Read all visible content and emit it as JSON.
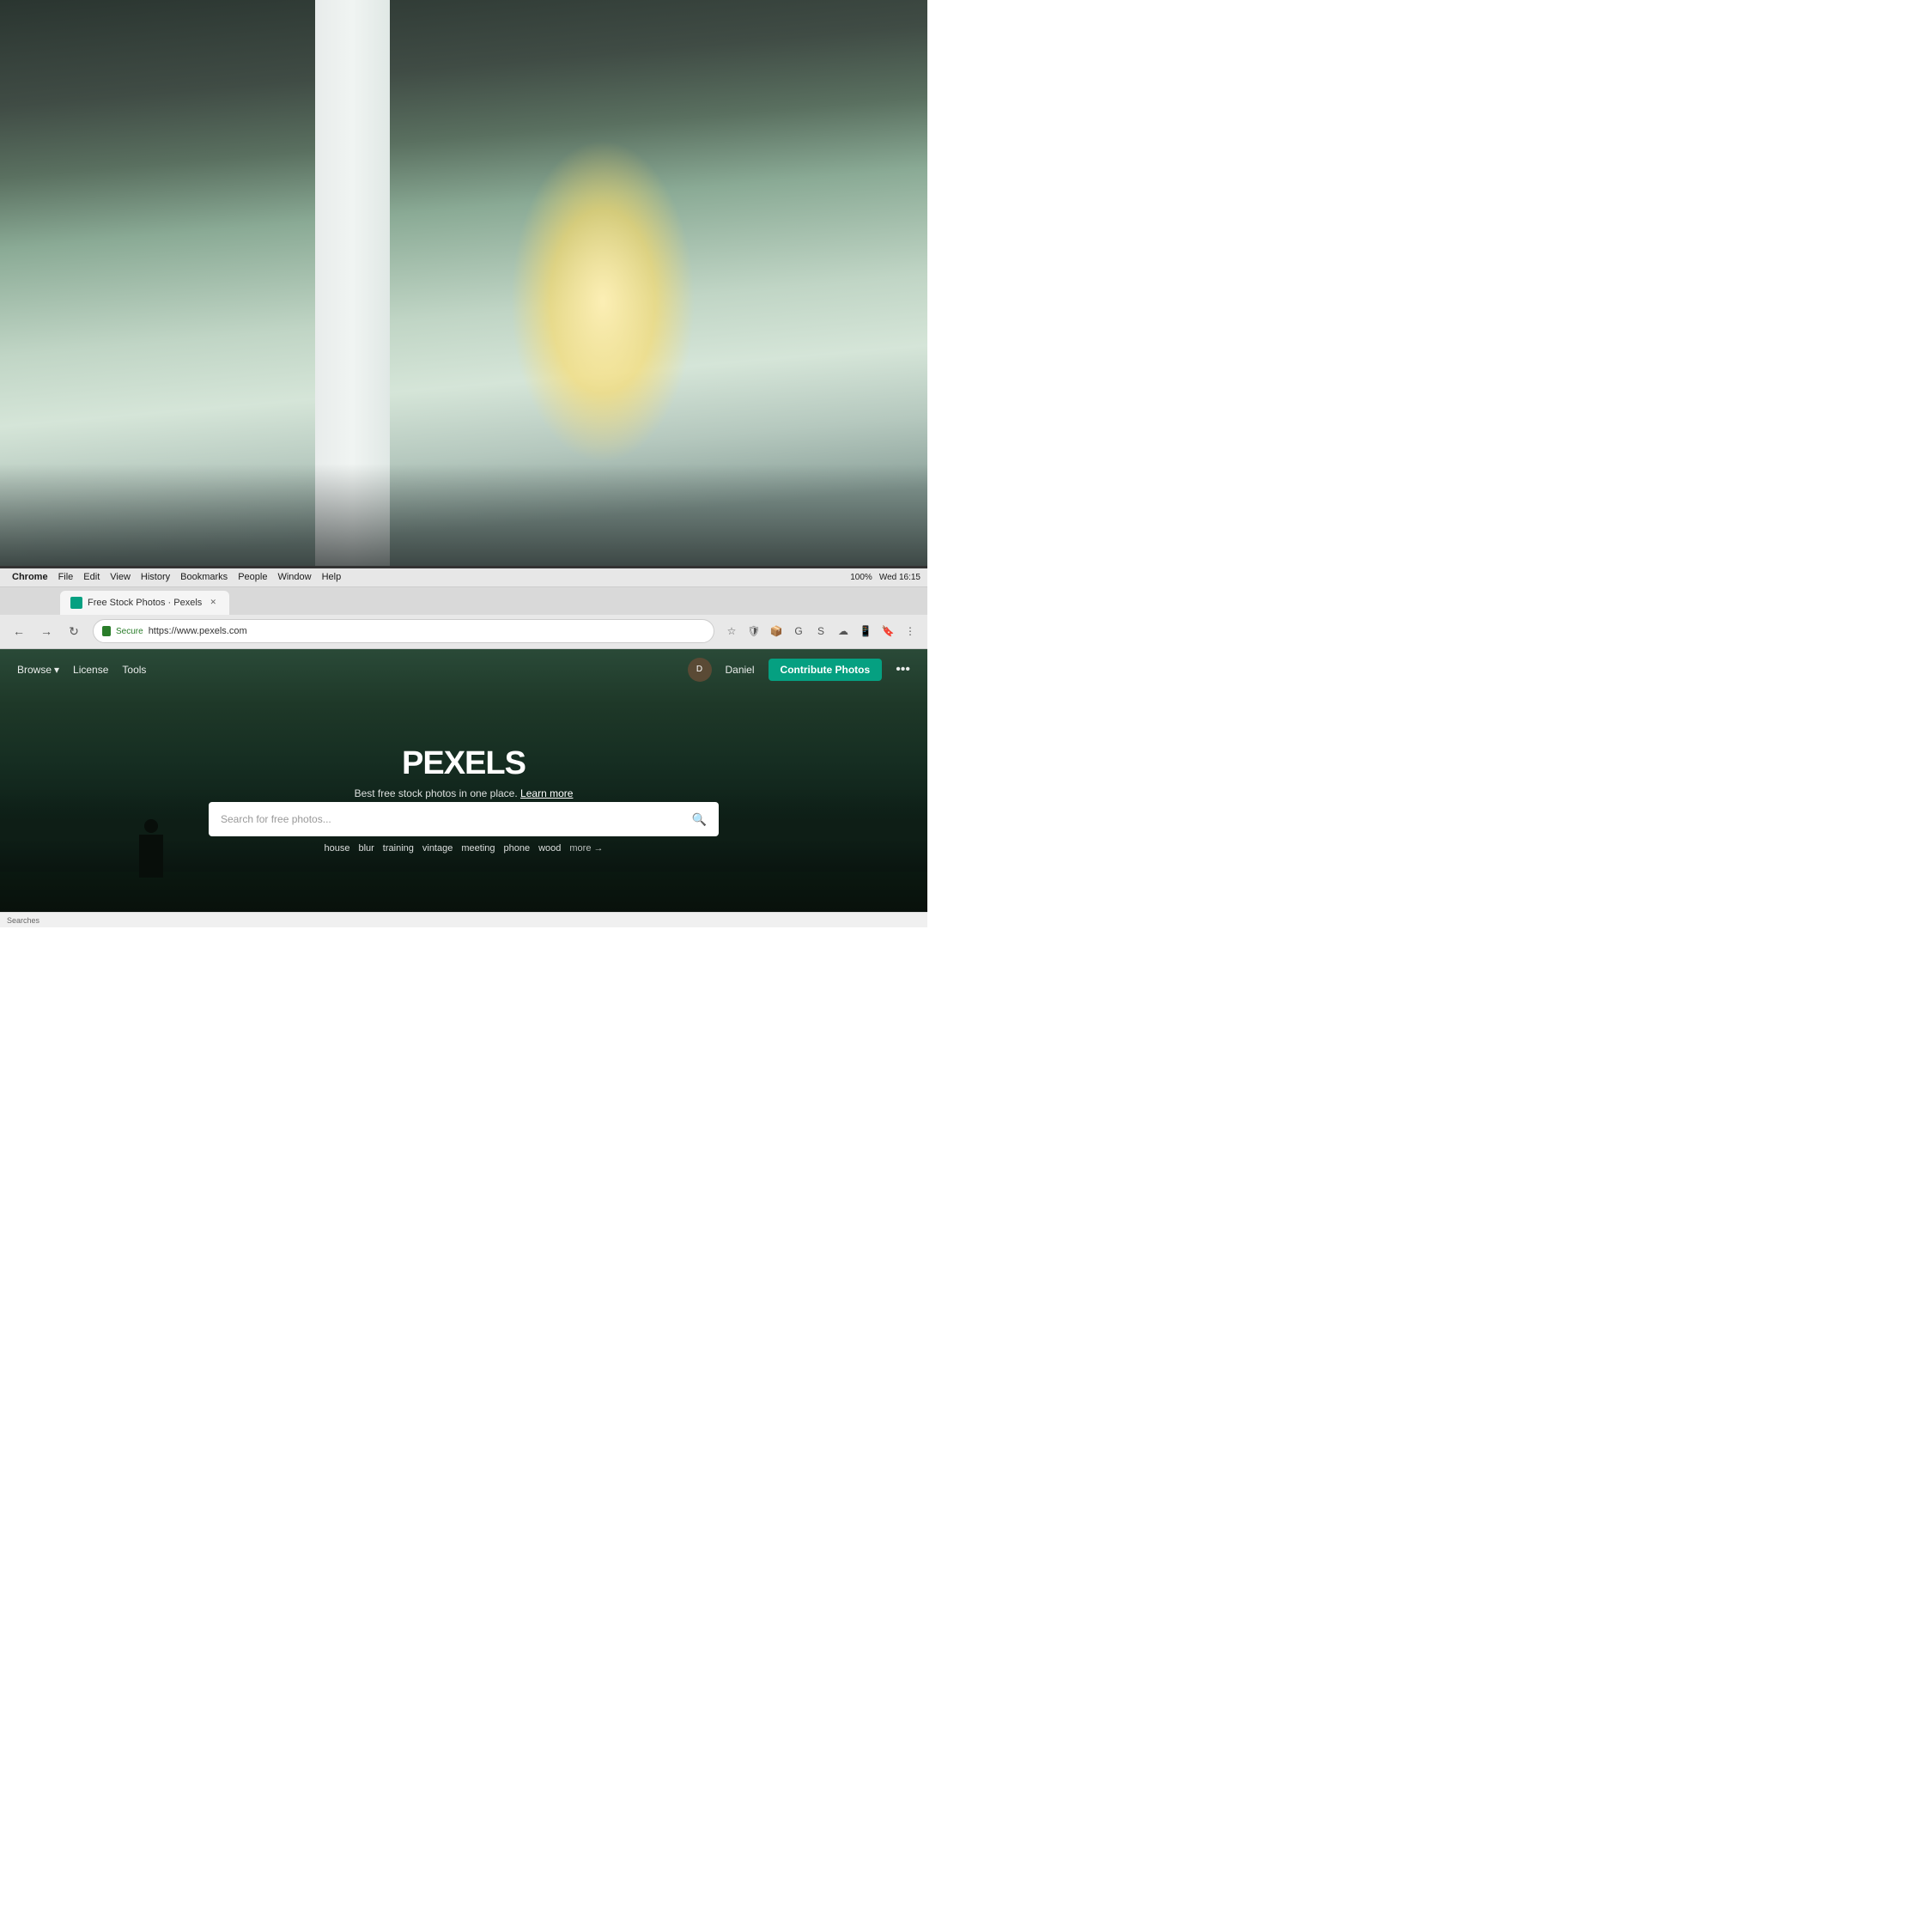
{
  "background": {
    "description": "Office workspace with natural light, blurry background"
  },
  "screen": {
    "border_color": "#1a1a1a"
  },
  "system": {
    "menubar": {
      "app": "Chrome",
      "items": [
        "File",
        "Edit",
        "View",
        "History",
        "Bookmarks",
        "People",
        "Window",
        "Help"
      ],
      "time": "Wed 16:15",
      "battery": "100%"
    }
  },
  "browser": {
    "tab": {
      "favicon_color": "#05a081",
      "title": "Free Stock Photos · Pexels"
    },
    "address": {
      "secure_label": "Secure",
      "url": "https://www.pexels.com"
    },
    "toolbar": {
      "back_icon": "←",
      "forward_icon": "→",
      "refresh_icon": "↻"
    }
  },
  "pexels": {
    "nav": {
      "browse_label": "Browse",
      "browse_arrow": "▾",
      "license_label": "License",
      "tools_label": "Tools",
      "user_name": "Daniel",
      "contribute_label": "Contribute Photos",
      "more_icon": "•••"
    },
    "hero": {
      "title": "PEXELS",
      "subtitle": "Best free stock photos in one place.",
      "learn_more": "Learn more"
    },
    "search": {
      "placeholder": "Search for free photos...",
      "search_icon": "🔍",
      "tags": [
        "house",
        "blur",
        "training",
        "vintage",
        "meeting",
        "phone",
        "wood"
      ],
      "more_label": "more →"
    }
  },
  "status_bar": {
    "text": "Searches"
  }
}
